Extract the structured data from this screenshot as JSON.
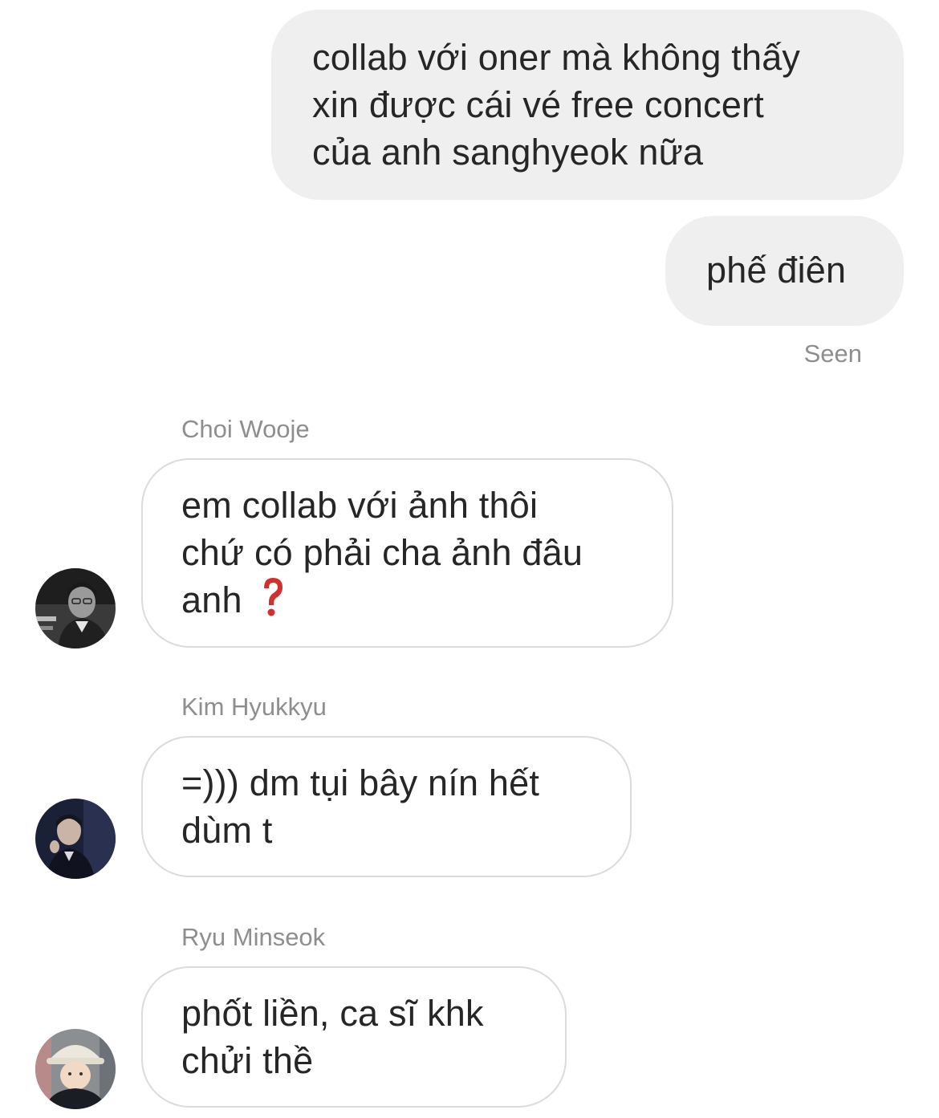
{
  "outgoing": [
    {
      "lines": [
        "collab với oner mà không thấy",
        "xin được cái vé free concert",
        "của anh sanghyeok nữa"
      ]
    },
    {
      "lines": [
        "phế điên"
      ]
    }
  ],
  "seen_label": "Seen",
  "incoming": [
    {
      "sender": "Choi Wooje",
      "lines": [
        "em collab với ảnh thôi",
        "chứ có phải cha ảnh đâu",
        "anh"
      ],
      "emoji_icon": "red-question-mark-icon",
      "avatar_icon": "user-avatar-icon"
    },
    {
      "sender": "Kim Hyukkyu",
      "lines": [
        "=))) dm tụi bây nín hết",
        "dùm t"
      ],
      "avatar_icon": "user-avatar-icon"
    },
    {
      "sender": "Ryu Minseok",
      "lines": [
        "phốt liền, ca sĩ khk",
        "chửi thề"
      ],
      "avatar_icon": "user-avatar-icon"
    }
  ],
  "colors": {
    "outgoing_bubble": "#efefef",
    "incoming_border": "#dbdbdb",
    "meta_text": "#8e8e8e",
    "message_text": "#262626",
    "emoji_red": "#d0312d"
  }
}
